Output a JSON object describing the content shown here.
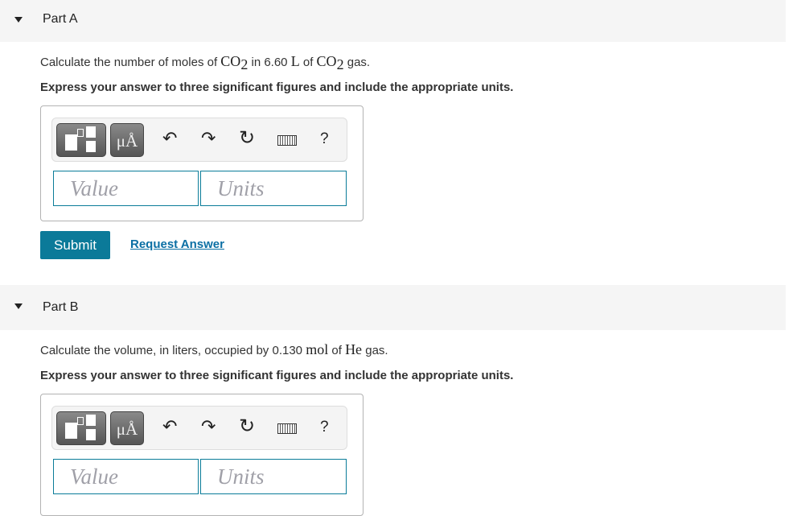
{
  "parts": [
    {
      "title": "Part A",
      "question": {
        "pre": "Calculate the number of moles of ",
        "f1": "CO",
        "s1": "2",
        "mid": " in 6.60 ",
        "u": "L",
        "mid2": " of ",
        "f2": "CO",
        "s2": "2",
        "post": " gas."
      },
      "instruction": "Express your answer to three significant figures and include the appropriate units.",
      "value_placeholder": "Value",
      "units_placeholder": "Units",
      "submit": "Submit",
      "request": "Request Answer"
    },
    {
      "title": "Part B",
      "question": {
        "pre": "Calculate the volume, in liters, occupied by 0.130 ",
        "u": "mol",
        "mid": " of ",
        "f1": "He",
        "post": " gas."
      },
      "instruction": "Express your answer to three significant figures and include the appropriate units.",
      "value_placeholder": "Value",
      "units_placeholder": "Units"
    }
  ],
  "toolbar": {
    "units_button": "μÅ",
    "help": "?",
    "icons": [
      "templates-icon",
      "units-icon",
      "undo-icon",
      "redo-icon",
      "reset-icon",
      "keyboard-icon",
      "help-icon"
    ]
  },
  "colors": {
    "accent": "#0b7a99",
    "header_bg": "#f5f5f5"
  }
}
